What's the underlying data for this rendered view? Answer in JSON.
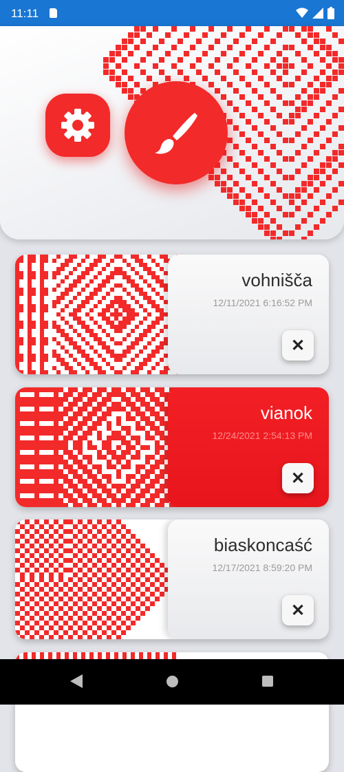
{
  "status_bar": {
    "time": "11:11",
    "icons": [
      "sd-card-icon",
      "wifi-icon",
      "cellular-signal-icon",
      "battery-icon"
    ]
  },
  "hero": {
    "buttons": [
      "settings-gear-icon",
      "paint-brush-icon"
    ]
  },
  "colors": {
    "accent": "#f22a2a",
    "status_bar": "#1976d2",
    "background": "#e2e4e9"
  },
  "patterns": [
    {
      "title": "vohnišča",
      "date": "12/11/2021 6:16:52 PM",
      "selected": false
    },
    {
      "title": "vianok",
      "date": "12/24/2021 2:54:13 PM",
      "selected": true
    },
    {
      "title": "biaskoncaść",
      "date": "12/17/2021 8:59:20 PM",
      "selected": false
    }
  ],
  "delete_label": "✕",
  "nav_bar": {
    "buttons": [
      "back-icon",
      "home-icon",
      "recents-icon"
    ]
  }
}
